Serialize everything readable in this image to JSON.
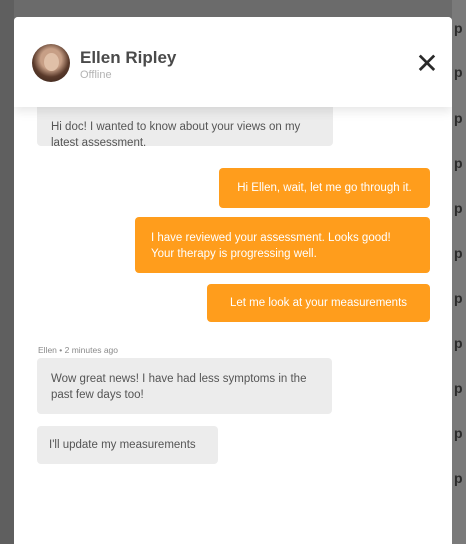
{
  "contact": {
    "name": "Ellen Ripley",
    "status": "Offline"
  },
  "header": {
    "close_icon": "close-icon",
    "close_glyph": "✕"
  },
  "background": {
    "right_fragments": [
      "p",
      "p",
      "p",
      "p",
      "p",
      "p",
      "p",
      "p",
      "p",
      "p",
      "p"
    ]
  },
  "messages": [
    {
      "direction": "incoming",
      "text": "Hi doc! I wanted to know about your views on my latest assessment."
    },
    {
      "direction": "outgoing",
      "text": "Hi Ellen, wait, let me go through it."
    },
    {
      "direction": "outgoing",
      "text": "I have reviewed your assessment. Looks good! Your therapy is progressing well."
    },
    {
      "direction": "outgoing",
      "text": "Let me look at your measurements"
    },
    {
      "direction": "incoming",
      "meta": "Ellen • 2 minutes ago",
      "text": "Wow great news! I have had less symptoms in the past few days too!"
    },
    {
      "direction": "incoming",
      "text": "I'll update my measurements"
    }
  ],
  "colors": {
    "outgoing_bubble": "#ff9d1c",
    "incoming_bubble": "#ececec",
    "overlay": "#6b6b6b"
  }
}
